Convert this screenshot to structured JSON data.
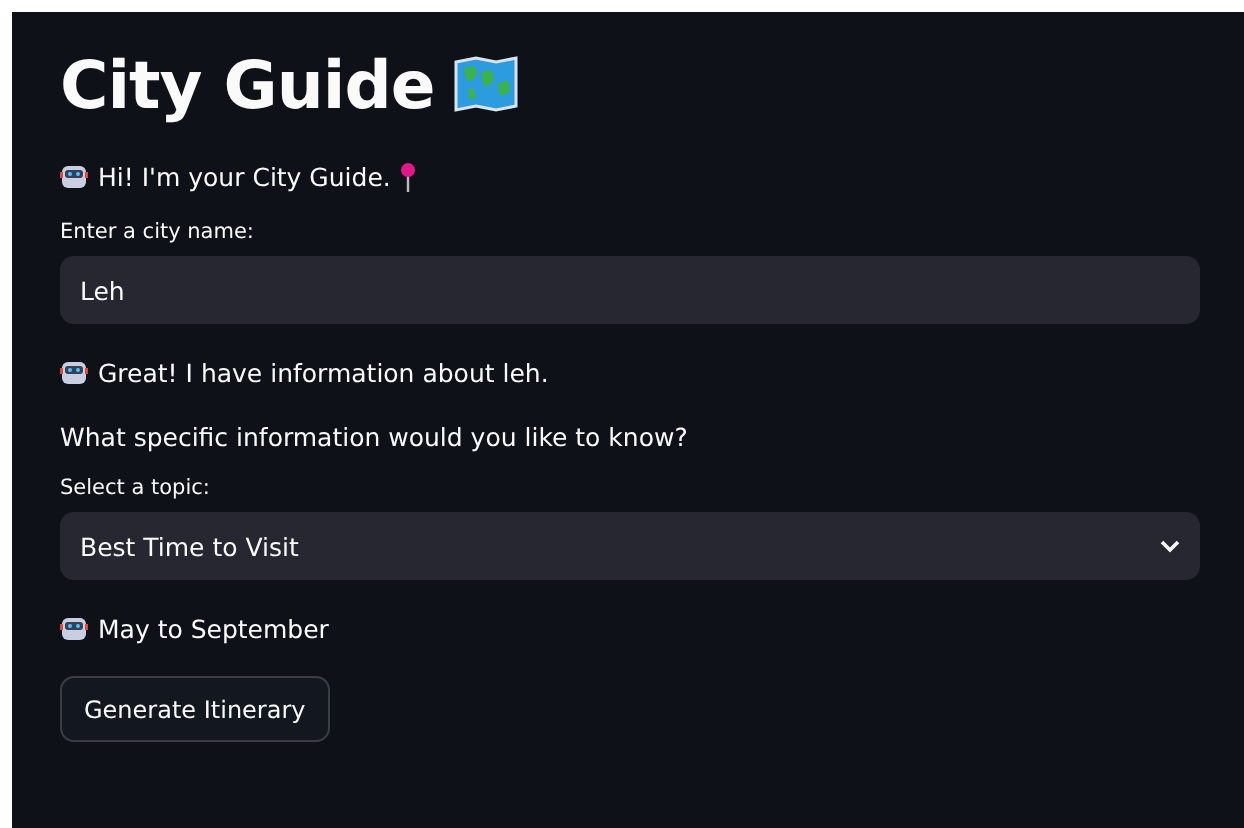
{
  "title": "City Guide",
  "blocks": [
    {
      "kind": "chat",
      "text": "Hi! I'm your City Guide."
    },
    {
      "kind": "input",
      "label": "Enter a city name:",
      "value": "Leh"
    },
    {
      "kind": "chat",
      "text": "Great! I have information about leh."
    },
    {
      "kind": "text",
      "text": "What specific information would you like to know?"
    },
    {
      "kind": "select",
      "label": "Select a topic:",
      "value": "Best Time to Visit"
    },
    {
      "kind": "chat",
      "text": "May to September"
    },
    {
      "kind": "button",
      "label": "Generate Itinerary"
    }
  ]
}
